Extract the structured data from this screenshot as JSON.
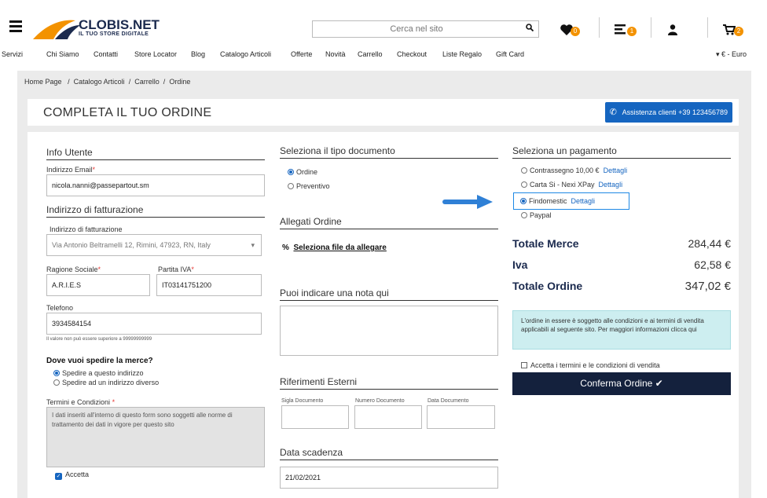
{
  "header": {
    "logo_text": "CLOBIS.NET",
    "logo_sub": "IL TUO STORE DIGITALE",
    "search_placeholder": "Cerca nel sito",
    "wishlist_count": "0",
    "list_count": "1",
    "cart_count": "2",
    "accent_color": "#f39200"
  },
  "nav": {
    "items": [
      "Servizi",
      "Chi Siamo",
      "Contatti",
      "Store Locator",
      "Blog",
      "Catalogo Articoli",
      "Offerte",
      "Novità",
      "Carrello",
      "Checkout",
      "Liste Regalo",
      "Gift Card"
    ],
    "currency": "€ - Euro"
  },
  "breadcrumb": {
    "items": [
      "Home Page",
      "Catalogo Articoli",
      "Carrello",
      "Ordine"
    ],
    "sep": "/"
  },
  "page": {
    "title": "COMPLETA IL TUO ORDINE",
    "assist_label": "Assistenza clienti +39 123456789"
  },
  "user": {
    "section_title": "Info Utente",
    "email_label": "Indirizzo Email",
    "email_value": "nicola.nanni@passepartout.sm",
    "billing_title": "Indirizzo di fatturazione",
    "billing_label": "Indirizzo di fatturazione",
    "billing_value": "Via Antonio Beltramelli 12, Rimini, 47923, RN, Italy",
    "ragione_label": "Ragione Sociale",
    "ragione_value": "A.R.I.E.S",
    "piva_label": "Partita IVA",
    "piva_value": "IT03141751200",
    "phone_label": "Telefono",
    "phone_value": "3934584154",
    "phone_hint": "Il valore non può essere superiore a 99999999999",
    "ship_title": "Dove vuoi spedire la merce?",
    "ship_opt1": "Spedire a questo indirizzo",
    "ship_opt2": "Spedire ad un indirizzo diverso",
    "terms_label": "Termini e Condizioni",
    "terms_text": "I dati inseriti all'interno di questo form sono soggetti alle norme di trattamento dei dati in vigore per questo sito",
    "accept_label": "Accetta"
  },
  "doc": {
    "section_title": "Seleziona il tipo documento",
    "opt1": "Ordine",
    "opt2": "Preventivo",
    "attach_title": "Allegati Ordine",
    "attach_link": "Seleziona file da allegare",
    "note_title": "Puoi indicare una nota qui",
    "ext_title": "Riferimenti Esterni",
    "sigla_label": "Sigla Documento",
    "numero_label": "Numero Documento",
    "data_label": "Data Documento",
    "scadenza_title": "Data scadenza",
    "scadenza_value": "21/02/2021"
  },
  "payment": {
    "section_title": "Seleziona un pagamento",
    "methods": [
      {
        "label": "Contrassegno 10,00 €",
        "link": "Dettagli"
      },
      {
        "label": "Carta Si - Nexi XPay",
        "link": "Dettagli"
      },
      {
        "label": "Findomestic",
        "link": "Dettagli"
      },
      {
        "label": "Paypal",
        "link": ""
      }
    ],
    "merce_label": "Totale Merce",
    "merce_value": "284,44 €",
    "iva_label": "Iva",
    "iva_value": "62,58 €",
    "ordine_label": "Totale Ordine",
    "ordine_value": "347,02 €",
    "info_text": "L'ordine in essere è soggetto alle condizioni e ai termini di vendita applicabili al seguente sito. Per maggiori informazioni",
    "info_link": "clicca qui",
    "accept_terms": "Accetta i termini e le condizioni di vendita",
    "confirm_label": "Conferma Ordine ✔"
  }
}
